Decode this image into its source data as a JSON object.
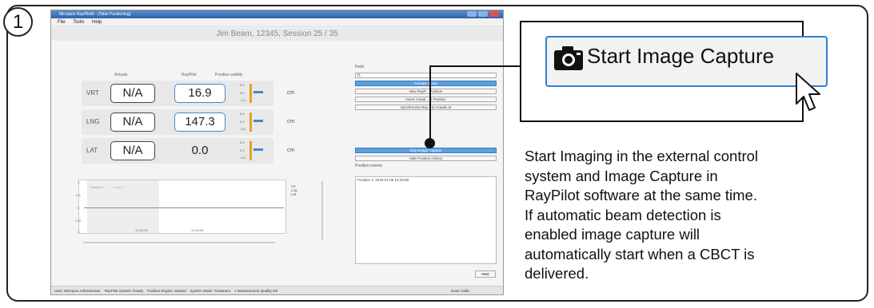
{
  "step_number": "1",
  "app": {
    "window_title": "Micropos RayPilot® - [Table Positioning]",
    "menu": [
      "File",
      "Tools",
      "Help"
    ],
    "patient_header": "Jim Beam, 12345, Session 25 / 35",
    "columns": {
      "actuals": "Actuals",
      "raypilot": "RayPilot",
      "validity": "Position validity"
    },
    "axes": [
      {
        "label": "VRT",
        "actual": "N/A",
        "raypilot": "16.9",
        "unit": "cm"
      },
      {
        "label": "LNG",
        "actual": "N/A",
        "raypilot": "147.3",
        "unit": "cm"
      },
      {
        "label": "LAT",
        "actual": "N/A",
        "raypilot": "0.0",
        "unit": "cm"
      }
    ],
    "validity_ticks": [
      "0.5",
      "0.0",
      "-0.5"
    ],
    "validity_value": "0.0",
    "graph": {
      "y_ticks": [
        "1",
        "0.5",
        "0",
        "-0.5",
        "-1"
      ],
      "x_ticks": [
        "14:24:30",
        "14:25:00"
      ],
      "segments": [
        "Position 1",
        "Image Ti..."
      ],
      "legend": [
        "Vrt",
        "Lng",
        "Lat"
      ]
    },
    "panel": {
      "field_label": "Field",
      "field_value": "f1",
      "buttons": [
        "Activate Setup",
        "New RayP... Position",
        "Insert Actual ...le Position",
        "Synchronize Ray... to Actuals at"
      ],
      "stop_capture": "Stop Image Capture",
      "hide_history": "Hide Position History",
      "events_label": "Position events",
      "event_item": "Position 1: 2016-01-05 14:23:58",
      "next": "Next"
    },
    "status_bar": [
      "User: Micropos Administrator",
      "RayPilot System: Ready",
      "Position Engine: Started",
      "System Mode: Treatment",
      "Measurement Quality OK",
      "Dose Calib.:"
    ]
  },
  "callout": {
    "button_label": "Start Image Capture",
    "camera_icon": "camera-icon",
    "cursor_icon": "pointer-cursor-icon"
  },
  "description_lines": [
    "Start Imaging in the external control",
    "system and Image Capture in",
    "RayPilot software at the same time.",
    "If automatic beam detection is",
    "enabled image capture will",
    "automatically start when a CBCT is",
    "delivered."
  ],
  "colors": {
    "accent": "#2f7fd0",
    "orange": "#e8a020"
  }
}
